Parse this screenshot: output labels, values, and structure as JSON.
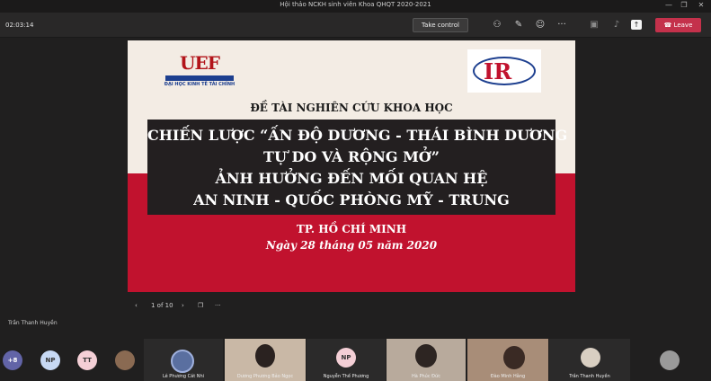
{
  "window": {
    "title": "Hội thảo NCKH sinh viên Khoa QHQT 2020-2021"
  },
  "controls": {
    "timer": "02:03:14",
    "take_control": "Take control",
    "leave": "Leave"
  },
  "slide": {
    "uef_logo_text": "UEF",
    "uef_logo_sub": "ĐẠI HỌC KINH TẾ TÀI CHÍNH",
    "ir_logo_text": "IR",
    "subtitle": "ĐỀ TÀI NGHIÊN CỨU KHOA HỌC",
    "title_lines": [
      "CHIẾN LƯỢC “ẤN ĐỘ DƯƠNG - THÁI BÌNH DƯƠNG",
      "TỰ DO VÀ RỘNG MỞ”",
      "ẢNH HƯỞNG ĐẾN MỐI QUAN HỆ",
      "AN NINH - QUỐC PHÒNG MỸ - TRUNG"
    ],
    "city": "TP. HỒ CHÍ MINH",
    "date": "Ngày 28 tháng 05 năm 2020"
  },
  "pager": {
    "prev": "‹",
    "label": "1 of 10",
    "next": "›",
    "more": "···"
  },
  "presenter_name": "Trần Thanh Huyền",
  "gallery": {
    "overflow_count": "+8",
    "initials": [
      "NP",
      "TT",
      "NP"
    ],
    "tiles": [
      {
        "name": "Lê Phương Cát Nhi"
      },
      {
        "name": "Dương Phương Bảo Ngọc"
      },
      {
        "name": "Nguyễn Thế Phương"
      },
      {
        "name": "Hà Phúc Đức"
      },
      {
        "name": "Đào Minh Hằng"
      },
      {
        "name": "Trần Thanh Huyền"
      }
    ]
  },
  "colors": {
    "leave": "#c4314b",
    "slide_red": "#c1122e",
    "banner": "#231f20",
    "accent_blue": "#1d3f8f"
  }
}
